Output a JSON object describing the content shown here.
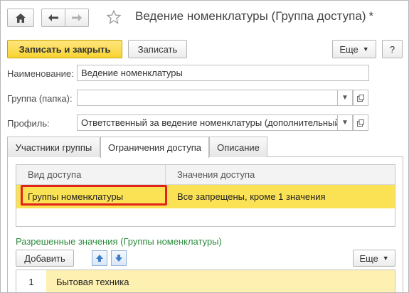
{
  "header": {
    "title": "Ведение номенклатуры (Группа доступа)",
    "modified_mark": "*",
    "home_icon": "home-icon",
    "back_icon": "arrow-left-icon",
    "forward_icon": "arrow-right-icon",
    "favorite_icon": "star-icon"
  },
  "toolbar": {
    "save_close_label": "Записать и закрыть",
    "save_label": "Записать",
    "more_label": "Еще",
    "help_label": "?"
  },
  "form": {
    "name_label": "Наименование:",
    "name_value": "Ведение номенклатуры",
    "group_label": "Группа (папка):",
    "group_value": "",
    "profile_label": "Профиль:",
    "profile_value": "Ответственный за ведение номенклатуры (дополнительный)"
  },
  "tabs": [
    {
      "label": "Участники группы",
      "active": false
    },
    {
      "label": "Ограничения доступа",
      "active": true
    },
    {
      "label": "Описание",
      "active": false
    }
  ],
  "access_table": {
    "columns": [
      "Вид доступа",
      "Значения доступа"
    ],
    "rows": [
      {
        "kind": "Группы номенклатуры",
        "values": "Все запрещены, кроме 1 значения",
        "selected": true
      }
    ]
  },
  "allowed_values": {
    "title": "Разрешенные значения (Группы номенклатуры)",
    "add_label": "Добавить",
    "more_label": "Еще",
    "move_up_icon": "arrow-up-icon",
    "move_down_icon": "arrow-down-icon",
    "rows": [
      {
        "number": "1",
        "name": "Бытовая техника"
      }
    ]
  },
  "colors": {
    "accent_yellow": "#f7d431",
    "selection_row": "#fbe255",
    "highlight_frame": "#e2231a",
    "section_green": "#2e8b3d"
  }
}
